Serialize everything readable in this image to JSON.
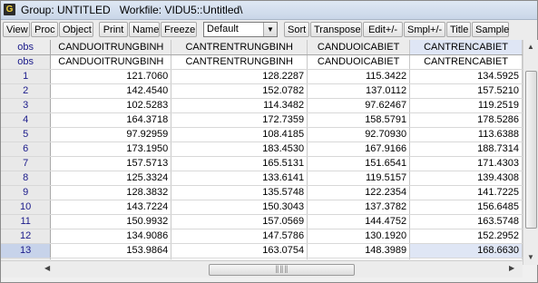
{
  "window": {
    "title": "Group: UNTITLED   Workfile: VIDU5::Untitled\\"
  },
  "app_icon_letter": "G",
  "toolbar": {
    "view": "View",
    "proc": "Proc",
    "object": "Object",
    "print": "Print",
    "name": "Name",
    "freeze": "Freeze",
    "format_selected": "Default",
    "sort": "Sort",
    "transpose": "Transpose",
    "edit": "Edit+/-",
    "smpl": "Smpl+/-",
    "title": "Title",
    "sample": "Sample"
  },
  "table": {
    "corner_label": "obs",
    "columns": [
      "CANDUOITRUNGBINH",
      "CANTRENTRUNGBINH",
      "CANDUOICABIET",
      "CANTRENCABIET"
    ],
    "rows": [
      {
        "obs": "obs",
        "v": [
          "CANDUOITRUNGBINH",
          "CANTRENTRUNGBINH",
          "CANDUOICABIET",
          "CANTRENCABIET"
        ]
      },
      {
        "obs": "1",
        "v": [
          "121.7060",
          "128.2287",
          "115.3422",
          "134.5925"
        ]
      },
      {
        "obs": "2",
        "v": [
          "142.4540",
          "152.0782",
          "137.0112",
          "157.5210"
        ]
      },
      {
        "obs": "3",
        "v": [
          "102.5283",
          "114.3482",
          "97.62467",
          "119.2519"
        ]
      },
      {
        "obs": "4",
        "v": [
          "164.3718",
          "172.7359",
          "158.5791",
          "178.5286"
        ]
      },
      {
        "obs": "5",
        "v": [
          "97.92959",
          "108.4185",
          "92.70930",
          "113.6388"
        ]
      },
      {
        "obs": "6",
        "v": [
          "173.1950",
          "183.4530",
          "167.9166",
          "188.7314"
        ]
      },
      {
        "obs": "7",
        "v": [
          "157.5713",
          "165.5131",
          "151.6541",
          "171.4303"
        ]
      },
      {
        "obs": "8",
        "v": [
          "125.3324",
          "133.6141",
          "119.5157",
          "139.4308"
        ]
      },
      {
        "obs": "9",
        "v": [
          "128.3832",
          "135.5748",
          "122.2354",
          "141.7225"
        ]
      },
      {
        "obs": "10",
        "v": [
          "143.7224",
          "150.3043",
          "137.3782",
          "156.6485"
        ]
      },
      {
        "obs": "11",
        "v": [
          "150.9932",
          "157.0569",
          "144.4752",
          "163.5748"
        ]
      },
      {
        "obs": "12",
        "v": [
          "134.9086",
          "147.5786",
          "130.1920",
          "152.2952"
        ]
      },
      {
        "obs": "13",
        "v": [
          "153.9864",
          "163.0754",
          "148.3989",
          "168.6630"
        ]
      }
    ]
  },
  "selection": {
    "row": "13",
    "column": "CANTRENCABIET"
  },
  "colors": {
    "selected_cell": "#dfe6f5",
    "obs_text": "#1a1a8a"
  },
  "icons": {
    "scroll_up": "triangle-up-icon",
    "scroll_down": "triangle-down-icon",
    "scroll_left": "triangle-left-icon",
    "scroll_right": "triangle-right-icon"
  }
}
